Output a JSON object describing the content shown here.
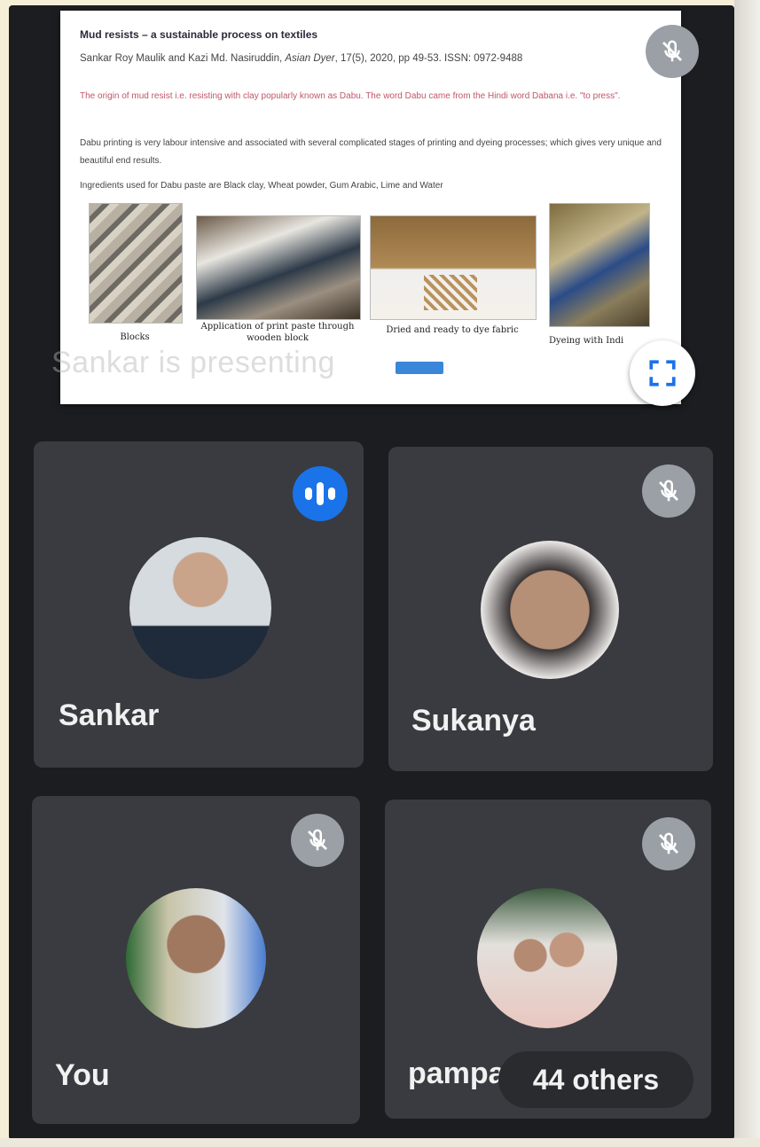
{
  "presentation": {
    "title": "Mud resists – a sustainable process on textiles",
    "citation_prefix": "Sankar Roy Maulik and Kazi Md. Nasiruddin, ",
    "citation_journal": "Asian Dyer",
    "citation_suffix": ", 17(5), 2020, pp 49-53. ISSN: 0972-9488",
    "origin_text": "The origin of mud resist i.e. resisting with clay popularly known as Dabu. The word Dabu came from the Hindi word Dabana i.e. \"to press\".",
    "body_text": "Dabu printing is very labour intensive and associated with several complicated stages of printing and dyeing processes; which gives very unique and beautiful end results.",
    "ingredients_text": "Ingredients used for Dabu paste are Black clay, Wheat powder, Gum Arabic, Lime and Water",
    "captions": [
      "Blocks",
      "Application of print paste through wooden block",
      "Dried and ready to dye fabric",
      "Dyeing with Indi"
    ],
    "presenting_label": "Sankar is presenting"
  },
  "participants": [
    {
      "name": "Sankar",
      "state": "speaking"
    },
    {
      "name": "Sukanya",
      "state": "muted"
    },
    {
      "name": "You",
      "state": "muted"
    },
    {
      "name": "pampa",
      "state": "muted"
    }
  ],
  "others_label": "44 others",
  "icons": {
    "muted": "mic-off-icon",
    "speaking": "audio-level-icon",
    "fullscreen": "fullscreen-icon"
  },
  "colors": {
    "speaking_accent": "#1a73e8",
    "muted_badge": "#9aa0a6",
    "tile_bg": "#3a3b40",
    "app_bg": "#1c1d21"
  }
}
